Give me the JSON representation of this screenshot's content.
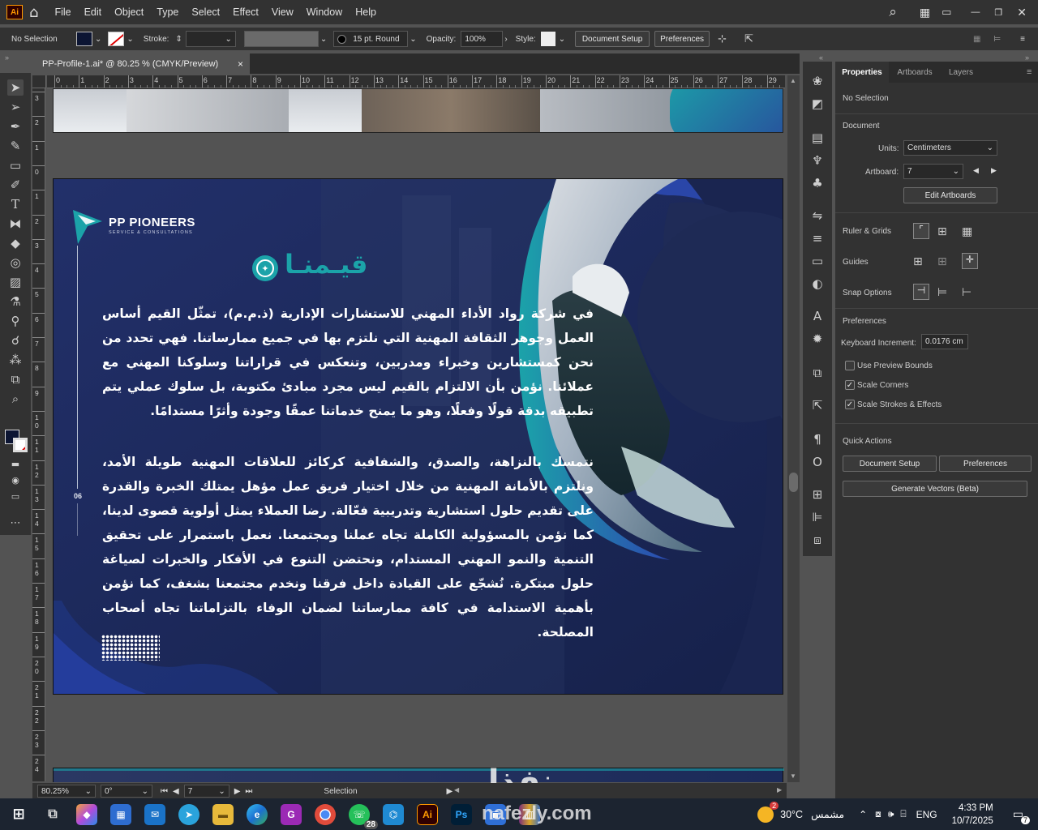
{
  "app": {
    "logo": "Ai"
  },
  "menu": [
    "File",
    "Edit",
    "Object",
    "Type",
    "Select",
    "Effect",
    "View",
    "Window",
    "Help"
  ],
  "control": {
    "selection": "No Selection",
    "stroke_label": "Stroke:",
    "brush": "15 pt. Round",
    "opacity_label": "Opacity:",
    "opacity": "100%",
    "style_label": "Style:",
    "document_setup": "Document Setup",
    "preferences": "Preferences"
  },
  "doc_tab": {
    "title": "PP-Profile-1.ai* @ 80.25 % (CMYK/Preview)",
    "close": "×"
  },
  "ruler": {
    "h": [
      "0",
      "1",
      "2",
      "3",
      "4",
      "5",
      "6",
      "7",
      "8",
      "9",
      "10",
      "11",
      "12",
      "13",
      "14",
      "15",
      "16",
      "17",
      "18",
      "19",
      "20",
      "21",
      "22",
      "23",
      "24",
      "25",
      "26",
      "27",
      "28",
      "29"
    ],
    "v": [
      "3",
      "2",
      "1",
      "0",
      "1",
      "2",
      "3",
      "4",
      "5",
      "6",
      "7",
      "8",
      "9",
      "1 0",
      "1 1",
      "1 2",
      "1 3",
      "1 4",
      "1 5",
      "1 6",
      "1 7",
      "1 8",
      "1 9",
      "2 0",
      "2 1",
      "2 2",
      "2 3",
      "2 4"
    ]
  },
  "artboard": {
    "brand": "PP PIONEERS",
    "tagline": "SERVICE & CONSULTATIONS",
    "heading": "قيـمنـا",
    "page_number": "06",
    "paragraph1": "في شركة رواد الأداء المهني للاستشارات الإدارية (ذ.م.م)، تمثّل القيم أساس العمل وجوهر الثقافة المهنية التي نلتزم بها في جميع ممارساتنا. فهي تحدد من نحن كمستشارين وخبراء ومدربين، وتنعكس في قراراتنا وسلوكنا المهني مع عملائنا. نؤمن بأن الالتزام بالقيم ليس مجرد مبادئ مكتوبة، بل سلوك عملي يتم تطبيقه بدقة قولًا وفعلًا، وهو ما يمنح خدماتنا عمقًا وجودة وأثرًا مستدامًا.",
    "paragraph2": "نتمسك بالنزاهة، والصدق، والشفافية كركائز للعلاقات المهنية طويلة الأمد، ونلتزم بالأمانة المهنية من خلال اختيار فريق عمل مؤهل يمتلك الخبرة والقدرة على تقديم حلول استشارية وتدريبية فعّالة. رضا العملاء يمثل أولوية قصوى لدينا، كما نؤمن بالمسؤولية الكاملة تجاه عملنا ومجتمعنا. نعمل باستمرار على تحقيق التنمية والنمو المهني المستدام، ونحتضن التنوع في الأفكار والخبرات لصياغة حلول مبتكرة. نُشجّع على القيادة داخل فرقنا ونخدم مجتمعنا بشغف، كما نؤمن بأهمية الاستدامة في كافة ممارساتنا لضمان الوفاء بالتزاماتنا تجاه أصحاب المصلحة."
  },
  "status": {
    "zoom": "80.25%",
    "rotation": "0°",
    "artboard": "7",
    "tool": "Selection"
  },
  "panel": {
    "tabs": [
      "Properties",
      "Artboards",
      "Layers"
    ],
    "no_selection": "No Selection",
    "document": "Document",
    "units_label": "Units:",
    "units": "Centimeters",
    "artboard_label": "Artboard:",
    "artboard_value": "7",
    "edit_artboards": "Edit Artboards",
    "ruler_grids": "Ruler & Grids",
    "guides": "Guides",
    "snap_options": "Snap Options",
    "preferences": "Preferences",
    "keyboard_increment_label": "Keyboard Increment:",
    "keyboard_increment": "0.0176 cm",
    "use_preview_bounds": "Use Preview Bounds",
    "scale_corners": "Scale Corners",
    "scale_strokes": "Scale Strokes & Effects",
    "quick_actions": "Quick Actions",
    "document_setup": "Document Setup",
    "preferences_btn": "Preferences",
    "generate_vectors": "Generate Vectors (Beta)"
  },
  "taskbar": {
    "temp": "30°C",
    "weather": "مشمس",
    "lang": "ENG",
    "time": "4:33 PM",
    "date": "10/7/2025",
    "whatsapp_badge": "28",
    "notif_badge": "2",
    "chat_badge": "7"
  },
  "watermark": {
    "ar": "نفذلي",
    "en": "nafezly.com"
  },
  "colors": {
    "accent": "#1ba3a9",
    "navy": "#1e2a4f",
    "ui_bg": "#323232"
  }
}
